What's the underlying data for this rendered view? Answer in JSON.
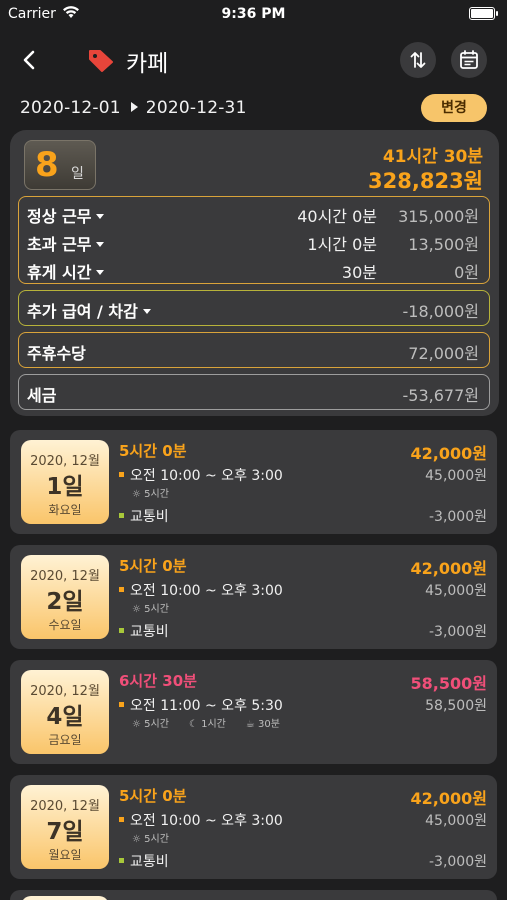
{
  "status_bar": {
    "carrier": "Carrier",
    "time": "9:36 PM"
  },
  "nav": {
    "title": "카페",
    "tag_icon": "tag-icon",
    "back_icon": "chevron-left-icon",
    "swap_icon": "swap-vertical-icon",
    "calendar_icon": "calendar-icon"
  },
  "date_range": {
    "start": "2020-12-01",
    "end": "2020-12-31",
    "change_label": "변경"
  },
  "summary": {
    "days": "8",
    "days_unit": "일",
    "total_hours": "41시간 30분",
    "total_pay": "328,823원",
    "work_rows": [
      {
        "label": "정상 근무",
        "hours": "40시간 0분",
        "amount": "315,000원"
      },
      {
        "label": "초과 근무",
        "hours": "1시간 0분",
        "amount": "13,500원"
      },
      {
        "label": "휴게 시간",
        "hours": "30분",
        "amount": "0원"
      }
    ],
    "extra": {
      "label": "추가 급여 / 차감",
      "amount": "-18,000원"
    },
    "holiday": {
      "label": "주휴수당",
      "amount": "72,000원"
    },
    "tax": {
      "label": "세금",
      "amount": "-53,677원"
    }
  },
  "days": [
    {
      "ym": "2020, 12월",
      "day": "1일",
      "dow": "화요일",
      "hours": "5시간 0분",
      "total": "42,000원",
      "shift": "오전 10:00 ~ 오후 3:00",
      "shift_pay": "45,000원",
      "normal": "5시간",
      "overtime": "",
      "break": "",
      "transport": "교통비",
      "transport_amount": "-3,000원"
    },
    {
      "ym": "2020, 12월",
      "day": "2일",
      "dow": "수요일",
      "hours": "5시간 0분",
      "total": "42,000원",
      "shift": "오전 10:00 ~ 오후 3:00",
      "shift_pay": "45,000원",
      "normal": "5시간",
      "overtime": "",
      "break": "",
      "transport": "교통비",
      "transport_amount": "-3,000원"
    },
    {
      "ym": "2020, 12월",
      "day": "4일",
      "dow": "금요일",
      "hours": "6시간 30분",
      "total": "58,500원",
      "shift": "오전 11:00 ~ 오후 5:30",
      "shift_pay": "58,500원",
      "normal": "5시간",
      "overtime": "1시간",
      "break": "30분",
      "transport": "",
      "transport_amount": ""
    },
    {
      "ym": "2020, 12월",
      "day": "7일",
      "dow": "월요일",
      "hours": "5시간 0분",
      "total": "42,000원",
      "shift": "오전 10:00 ~ 오후 3:00",
      "shift_pay": "45,000원",
      "normal": "5시간",
      "overtime": "",
      "break": "",
      "transport": "교통비",
      "transport_amount": "-3,000원"
    }
  ],
  "colors": {
    "accent": "#f9a31b",
    "highlight_pink": "#f04f79",
    "card_bg": "#3a3a3c",
    "page_bg": "#1e1e1f"
  }
}
